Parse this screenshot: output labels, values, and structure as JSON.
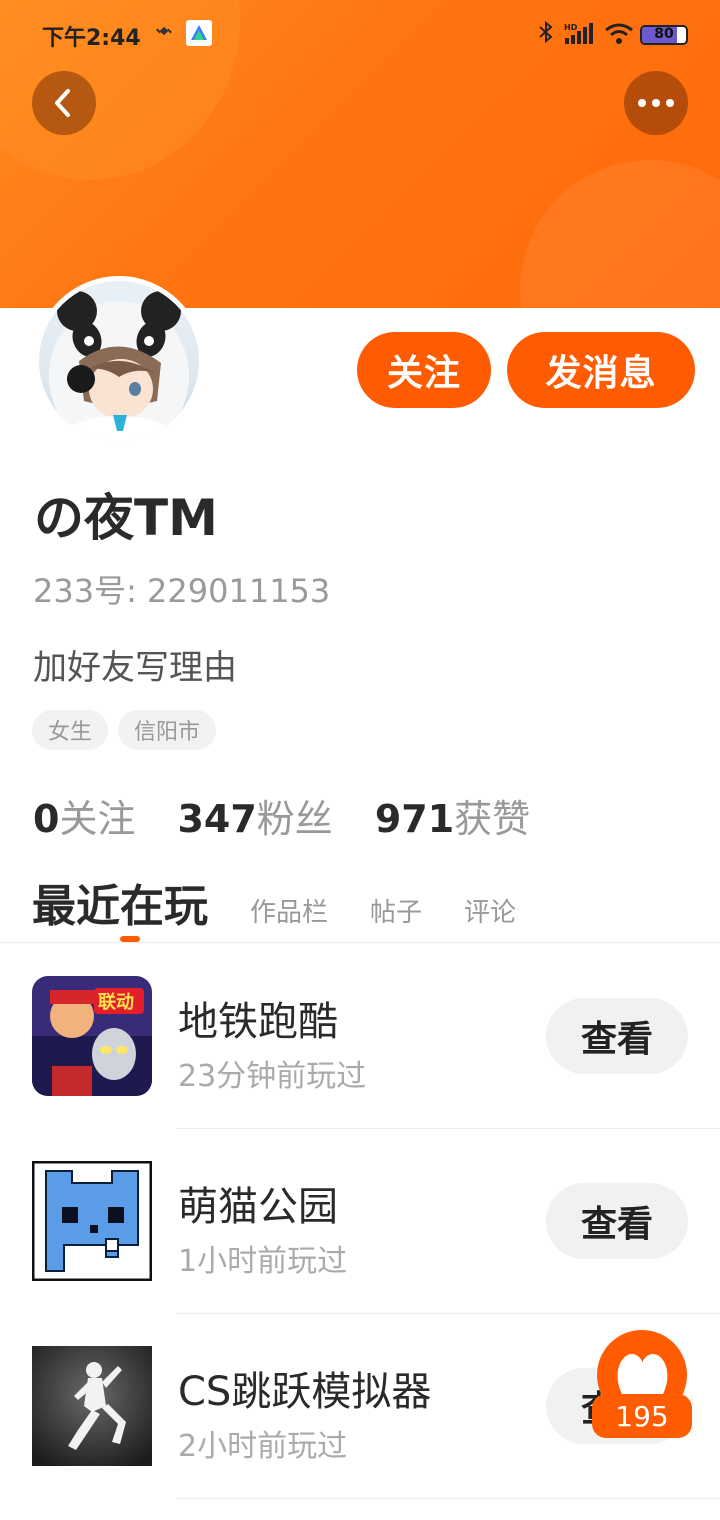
{
  "status_bar": {
    "time": "下午2:44",
    "battery": "80",
    "battery_level": 0.8,
    "icons": [
      "satellite-icon",
      "app-notification-icon",
      "bluetooth-icon",
      "signal-icon",
      "wifi-icon",
      "battery-icon"
    ]
  },
  "header": {
    "back_icon": "chevron-left-icon",
    "more_icon": "more-horizontal-icon"
  },
  "profile": {
    "name": "の夜TM",
    "id_line": "233号: 229011153",
    "bio": "加好友写理由",
    "tags": [
      "女生",
      "信阳市"
    ],
    "follow_label": "关注",
    "message_label": "发消息"
  },
  "stats": [
    {
      "value": "0",
      "label": "关注"
    },
    {
      "value": "347",
      "label": "粉丝"
    },
    {
      "value": "971",
      "label": "获赞"
    }
  ],
  "tabs": [
    {
      "label": "最近在玩",
      "active": true
    },
    {
      "label": "作品栏",
      "active": false
    },
    {
      "label": "帖子",
      "active": false
    },
    {
      "label": "评论",
      "active": false
    }
  ],
  "games": [
    {
      "title": "地铁跑酷",
      "played": "23分钟前玩过",
      "button": "查看"
    },
    {
      "title": "萌猫公园",
      "played": "1小时前玩过",
      "button": "查看"
    },
    {
      "title": "CS跳跃模拟器",
      "played": "2小时前玩过",
      "button": "查看"
    }
  ],
  "like_fab": {
    "count": "195"
  },
  "colors": {
    "accent": "#ff5b00",
    "banner": "#ff7411"
  }
}
